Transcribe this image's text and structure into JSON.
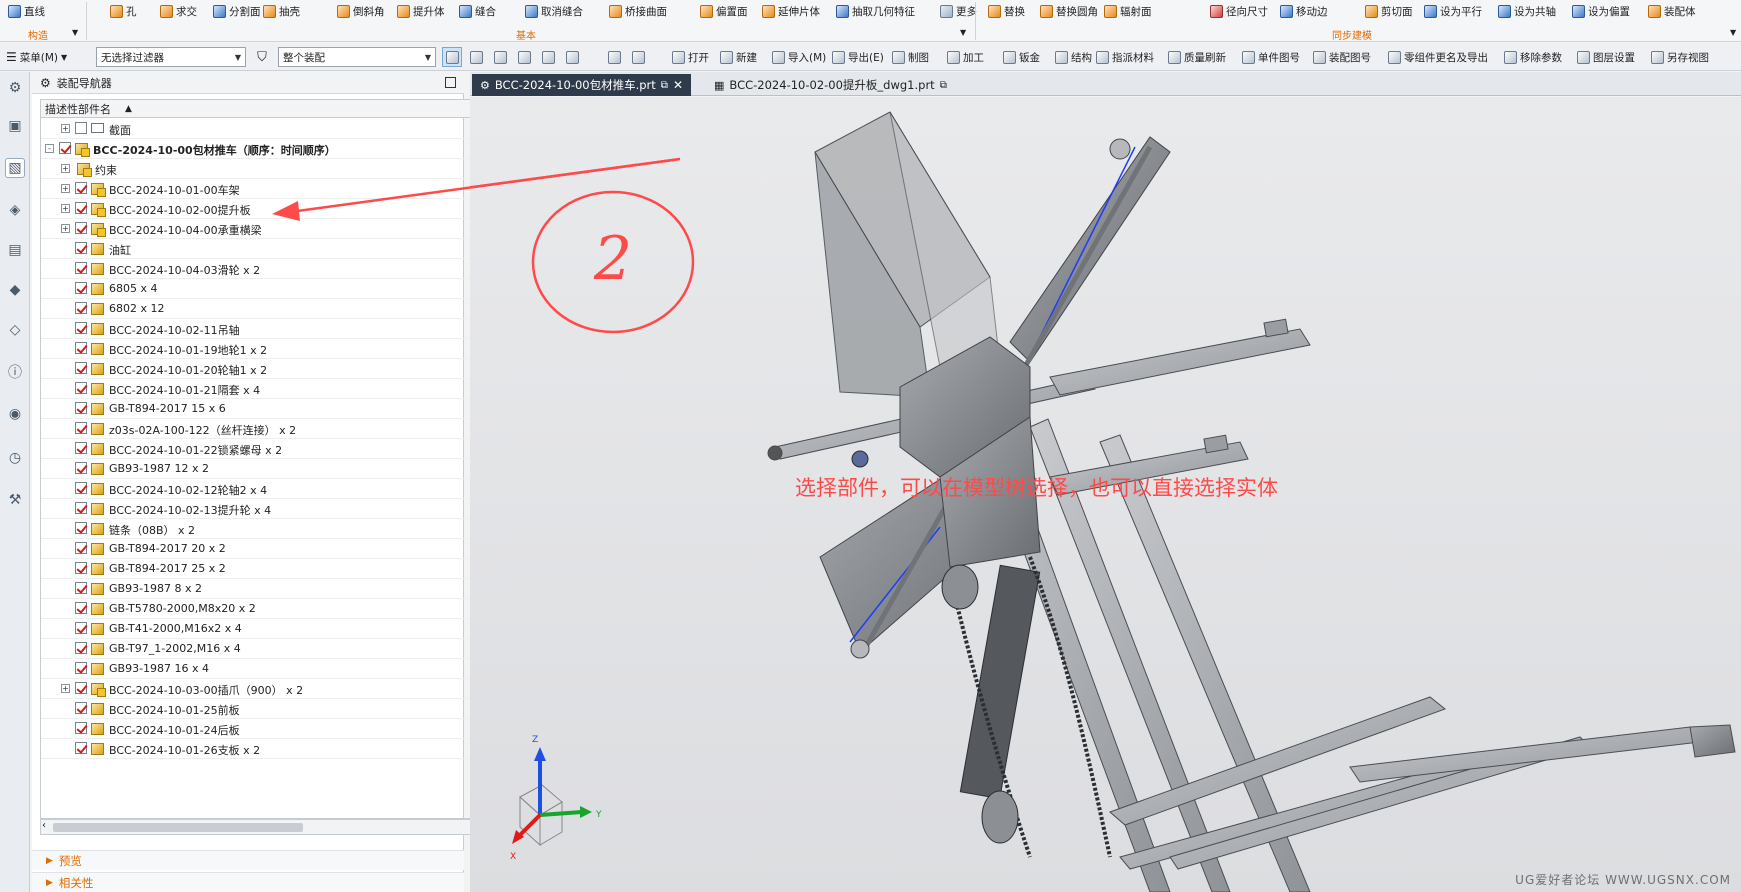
{
  "ribbon": {
    "row": [
      {
        "label": "直线",
        "icon": "line-icon"
      },
      {
        "label": "孔",
        "icon": "hole-icon"
      },
      {
        "label": "求交",
        "icon": "intersect-icon"
      },
      {
        "label": "分割面",
        "icon": "divide-face-icon"
      },
      {
        "label": "抽壳",
        "icon": "shell-icon"
      },
      {
        "label": "倒斜角",
        "icon": "chamfer-icon"
      },
      {
        "label": "提升体",
        "icon": "promote-body-icon"
      },
      {
        "label": "缝合",
        "icon": "sew-icon"
      },
      {
        "label": "取消缝合",
        "icon": "unsew-icon"
      },
      {
        "label": "桥接曲面",
        "icon": "bridge-surface-icon"
      },
      {
        "label": "偏置面",
        "icon": "offset-face-icon"
      },
      {
        "label": "延伸片体",
        "icon": "extend-sheet-icon"
      },
      {
        "label": "抽取几何特征",
        "icon": "extract-geometry-icon"
      },
      {
        "label": "更多",
        "icon": "more-icon"
      },
      {
        "label": "替换",
        "icon": "replace-icon"
      },
      {
        "label": "替换圆角",
        "icon": "replace-blend-icon"
      },
      {
        "label": "辐射面",
        "icon": "radiate-face-icon"
      },
      {
        "label": "径向尺寸",
        "icon": "radial-dimension-icon"
      },
      {
        "label": "移动边",
        "icon": "move-edge-icon"
      },
      {
        "label": "剪切面",
        "icon": "cut-face-icon"
      },
      {
        "label": "设为平行",
        "icon": "make-parallel-icon"
      },
      {
        "label": "设为共轴",
        "icon": "make-coaxial-icon"
      },
      {
        "label": "设为偏置",
        "icon": "make-offset-icon"
      },
      {
        "label": "装配体",
        "icon": "assembly-icon"
      }
    ],
    "groups": {
      "construct": "构造",
      "basic": "基本",
      "sync": "同步建模"
    }
  },
  "toolbar": {
    "menu_label": "菜单(M)",
    "filter_value": "无选择过滤器",
    "scope_value": "整个装配",
    "items": [
      {
        "label": "打开",
        "icon": "open-icon"
      },
      {
        "label": "新建",
        "icon": "new-icon"
      },
      {
        "label": "导入(M)",
        "icon": "import-icon"
      },
      {
        "label": "导出(E)",
        "icon": "export-icon"
      },
      {
        "label": "制图",
        "icon": "drafting-icon"
      },
      {
        "label": "加工",
        "icon": "machining-icon"
      },
      {
        "label": "钣金",
        "icon": "sheet-metal-icon"
      },
      {
        "label": "结构",
        "icon": "structure-icon"
      },
      {
        "label": "指派材料",
        "icon": "assign-material-icon"
      },
      {
        "label": "质量刷新",
        "icon": "mass-refresh-icon"
      },
      {
        "label": "单件图号",
        "icon": "part-number-icon"
      },
      {
        "label": "装配图号",
        "icon": "assembly-number-icon"
      },
      {
        "label": "零组件更名及导出",
        "icon": "rename-export-icon"
      },
      {
        "label": "移除参数",
        "icon": "remove-params-icon"
      },
      {
        "label": "图层设置",
        "icon": "layer-settings-icon"
      },
      {
        "label": "另存视图",
        "icon": "save-view-icon"
      }
    ]
  },
  "navigator": {
    "title": "装配导航器",
    "column_header": "描述性部件名",
    "rows": [
      {
        "label": "截面",
        "level": 1,
        "expander": "+",
        "checked": false,
        "icon": "folder"
      },
      {
        "label": "BCC-2024-10-00包材推车（顺序：时间顺序）",
        "level": 0,
        "expander": "-",
        "checked": true,
        "icon": "assembly",
        "bold": true
      },
      {
        "label": "约束",
        "level": 1,
        "expander": "+",
        "checked": null,
        "icon": "constraint"
      },
      {
        "label": "BCC-2024-10-01-00车架",
        "level": 1,
        "expander": "+",
        "checked": true,
        "icon": "assembly"
      },
      {
        "label": "BCC-2024-10-02-00提升板",
        "level": 1,
        "expander": "+",
        "checked": true,
        "icon": "assembly"
      },
      {
        "label": "BCC-2024-10-04-00承重横梁",
        "level": 1,
        "expander": "+",
        "checked": true,
        "icon": "assembly"
      },
      {
        "label": "油缸",
        "level": 1,
        "expander": "",
        "checked": true,
        "icon": "part"
      },
      {
        "label": "BCC-2024-10-04-03滑轮 x 2",
        "level": 1,
        "expander": "",
        "checked": true,
        "icon": "part"
      },
      {
        "label": "6805 x 4",
        "level": 1,
        "expander": "",
        "checked": true,
        "icon": "part"
      },
      {
        "label": "6802 x 12",
        "level": 1,
        "expander": "",
        "checked": true,
        "icon": "part"
      },
      {
        "label": "BCC-2024-10-02-11吊轴",
        "level": 1,
        "expander": "",
        "checked": true,
        "icon": "part"
      },
      {
        "label": "BCC-2024-10-01-19地轮1 x 2",
        "level": 1,
        "expander": "",
        "checked": true,
        "icon": "part"
      },
      {
        "label": "BCC-2024-10-01-20轮轴1 x 2",
        "level": 1,
        "expander": "",
        "checked": true,
        "icon": "part"
      },
      {
        "label": "BCC-2024-10-01-21隔套 x 4",
        "level": 1,
        "expander": "",
        "checked": true,
        "icon": "part"
      },
      {
        "label": "GB-T894-2017 15 x 6",
        "level": 1,
        "expander": "",
        "checked": true,
        "icon": "part"
      },
      {
        "label": "z03s-02A-100-122（丝杆连接） x 2",
        "level": 1,
        "expander": "",
        "checked": true,
        "icon": "part"
      },
      {
        "label": "BCC-2024-10-01-22锁紧螺母 x 2",
        "level": 1,
        "expander": "",
        "checked": true,
        "icon": "part"
      },
      {
        "label": "GB93-1987 12 x 2",
        "level": 1,
        "expander": "",
        "checked": true,
        "icon": "part"
      },
      {
        "label": "BCC-2024-10-02-12轮轴2 x 4",
        "level": 1,
        "expander": "",
        "checked": true,
        "icon": "part"
      },
      {
        "label": "BCC-2024-10-02-13提升轮 x 4",
        "level": 1,
        "expander": "",
        "checked": true,
        "icon": "part"
      },
      {
        "label": "链条（08B） x 2",
        "level": 1,
        "expander": "",
        "checked": true,
        "icon": "part"
      },
      {
        "label": "GB-T894-2017 20 x 2",
        "level": 1,
        "expander": "",
        "checked": true,
        "icon": "part"
      },
      {
        "label": "GB-T894-2017 25 x 2",
        "level": 1,
        "expander": "",
        "checked": true,
        "icon": "part"
      },
      {
        "label": "GB93-1987 8 x 2",
        "level": 1,
        "expander": "",
        "checked": true,
        "icon": "part"
      },
      {
        "label": "GB-T5780-2000,M8x20 x 2",
        "level": 1,
        "expander": "",
        "checked": true,
        "icon": "part"
      },
      {
        "label": "GB-T41-2000,M16x2 x 4",
        "level": 1,
        "expander": "",
        "checked": true,
        "icon": "part"
      },
      {
        "label": "GB-T97_1-2002,M16 x 4",
        "level": 1,
        "expander": "",
        "checked": true,
        "icon": "part"
      },
      {
        "label": "GB93-1987 16 x 4",
        "level": 1,
        "expander": "",
        "checked": true,
        "icon": "part"
      },
      {
        "label": "BCC-2024-10-03-00插爪（900） x 2",
        "level": 1,
        "expander": "+",
        "checked": true,
        "icon": "assembly"
      },
      {
        "label": "BCC-2024-10-01-25前板",
        "level": 1,
        "expander": "",
        "checked": true,
        "icon": "part"
      },
      {
        "label": "BCC-2024-10-01-24后板",
        "level": 1,
        "expander": "",
        "checked": true,
        "icon": "part"
      },
      {
        "label": "BCC-2024-10-01-26支板 x 2",
        "level": 1,
        "expander": "",
        "checked": true,
        "icon": "part"
      }
    ],
    "preview_label": "预览",
    "related_label": "相关性"
  },
  "tabs": [
    {
      "label": "BCC-2024-10-00包材推车.prt",
      "active": true
    },
    {
      "label": "BCC-2024-10-02-00提升板_dwg1.prt",
      "active": false
    }
  ],
  "viewport": {
    "annotation_text": "选择部件，可以在模型树选择，也可以直接选择实体",
    "annotation_number": "2",
    "axis_labels": {
      "x": "X",
      "y": "Y",
      "z": "Z"
    },
    "watermark": "UG爱好者论坛 WWW.UGSNX.COM"
  },
  "colors": {
    "annotation": "#ff4a4a",
    "accent": "#e06b00",
    "selection_edge": "#1b3cff"
  }
}
